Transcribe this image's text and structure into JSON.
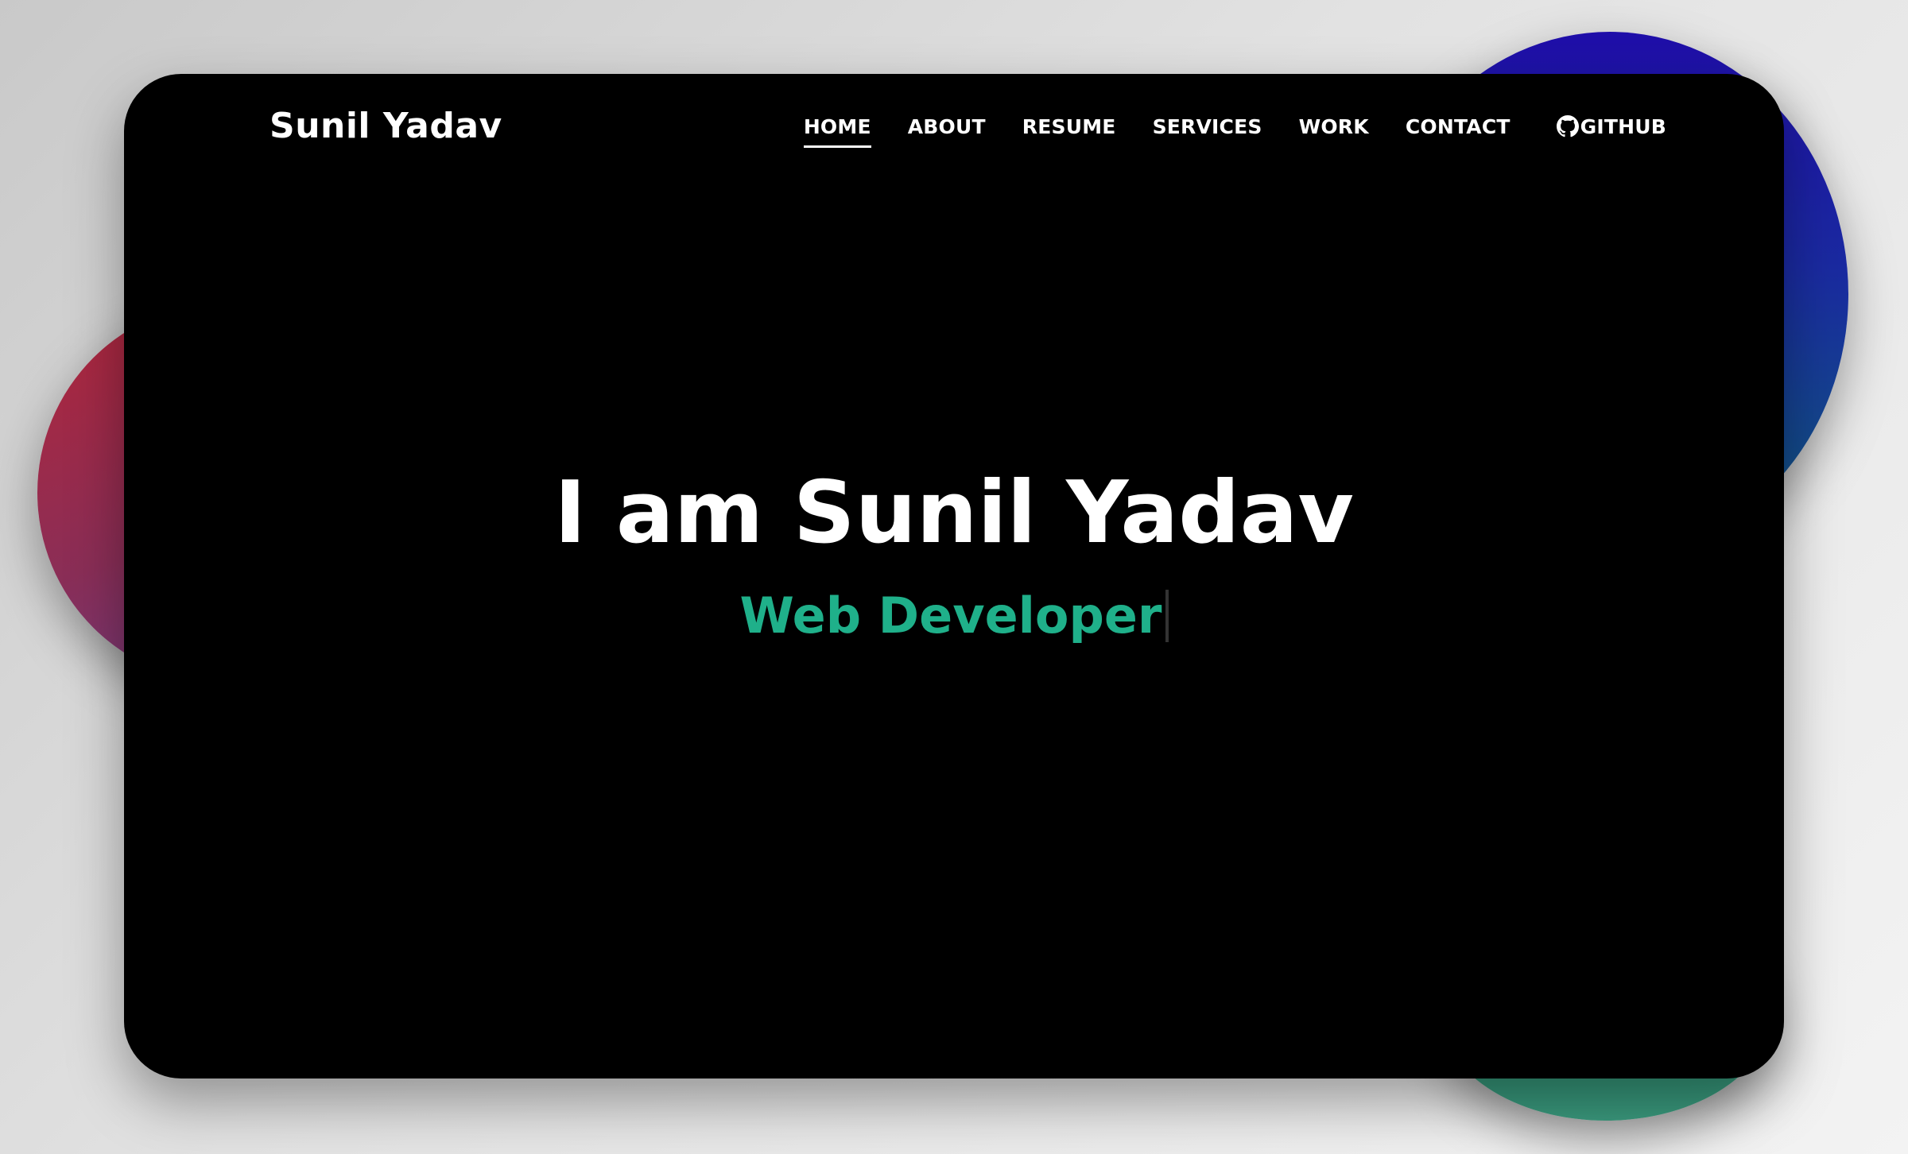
{
  "header": {
    "brand": "Sunil Yadav"
  },
  "nav": {
    "items": [
      {
        "label": "HOME",
        "active": true
      },
      {
        "label": "ABOUT",
        "active": false
      },
      {
        "label": "RESUME",
        "active": false
      },
      {
        "label": "SERVICES",
        "active": false
      },
      {
        "label": "WORK",
        "active": false
      },
      {
        "label": "CONTACT",
        "active": false
      }
    ],
    "github": {
      "label": "GITHUB",
      "icon": "github-icon"
    }
  },
  "hero": {
    "title": "I am Sunil Yadav",
    "subtitle": "Web Developer"
  },
  "colors": {
    "card_background": "#000000",
    "text": "#ffffff",
    "accent": "#1fb08a",
    "page_background": "#e0e0e0"
  }
}
